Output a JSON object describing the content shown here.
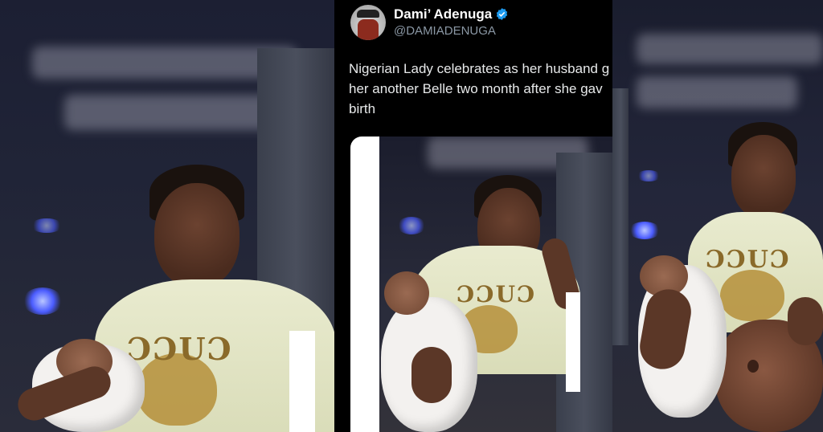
{
  "tweet": {
    "display_name": "Dami’ Adenuga",
    "handle": "@DAMIADENUGA",
    "text_lines": [
      "Nigerian Lady celebrates as her husband g",
      "her another Belle  two month after she gav",
      "birth"
    ]
  },
  "colors": {
    "verified": "#1d9bf0",
    "tweet_bg": "#000000",
    "handle": "#8b98a5"
  },
  "shirt_logo": "ƆƆUƆ"
}
